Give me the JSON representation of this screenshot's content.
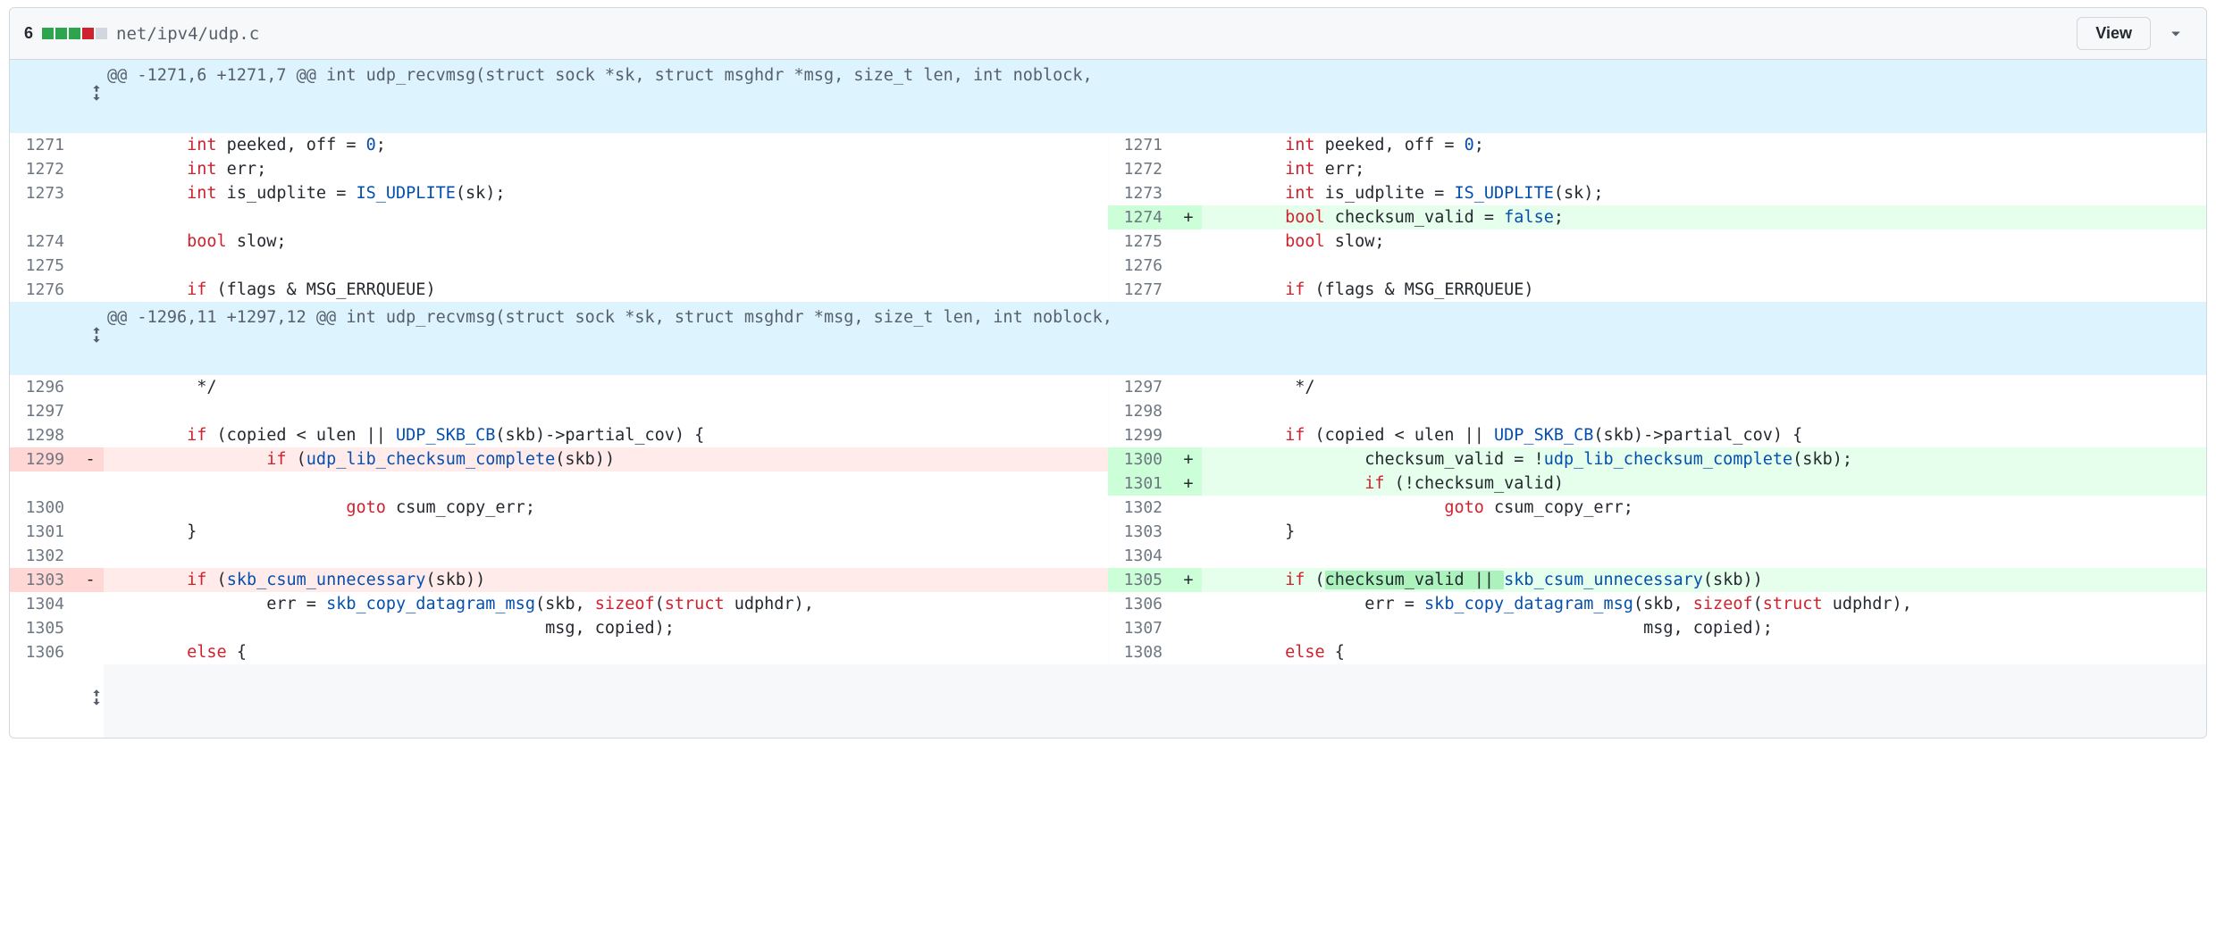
{
  "header": {
    "changes": "6",
    "path": "net/ipv4/udp.c",
    "view_label": "View"
  },
  "hunk1": "@@ -1271,6 +1271,7 @@ int udp_recvmsg(struct sock *sk, struct msghdr *msg, size_t len, int noblock,",
  "hunk2": "@@ -1296,11 +1297,12 @@ int udp_recvmsg(struct sock *sk, struct msghdr *msg, size_t len, int noblock,",
  "ln": {
    "l1271": "1271",
    "l1272": "1272",
    "l1273": "1273",
    "l1274": "1274",
    "l1275": "1275",
    "l1276": "1276",
    "l1296": "1296",
    "l1297": "1297",
    "l1298": "1298",
    "l1299": "1299",
    "l1300": "1300",
    "l1301": "1301",
    "l1302": "1302",
    "l1303": "1303",
    "l1304": "1304",
    "l1305": "1305",
    "l1306": "1306",
    "r1271": "1271",
    "r1272": "1272",
    "r1273": "1273",
    "r1274": "1274",
    "r1275": "1275",
    "r1276": "1276",
    "r1277": "1277",
    "r1297": "1297",
    "r1298": "1298",
    "r1299": "1299",
    "r1300": "1300",
    "r1301": "1301",
    "r1302": "1302",
    "r1303": "1303",
    "r1304": "1304",
    "r1305": "1305",
    "r1306": "1306",
    "r1307": "1307",
    "r1308": "1308"
  },
  "t": {
    "plus": "+",
    "minus": "-",
    "int": "int",
    "bool": "bool",
    "if": "if",
    "goto": "goto",
    "else": "else",
    "sizeof": "sizeof",
    "struct": "struct",
    "peeked_off": " peeked, off = ",
    "zero": "0",
    "semi": ";",
    "err": " err;",
    "is_udplite": " is_udplite = ",
    "IS_UDPLITE": "IS_UDPLITE",
    "sk_call": "(sk);",
    "checksum_valid_decl": " checksum_valid = ",
    "false": "false",
    "slow": " slow;",
    "flags": " (flags & MSG_ERRQUEUE)",
    "star_close": " */",
    "copied": " (copied < ulen || ",
    "UDP_SKB_CB": "UDP_SKB_CB",
    "skb_partial": "(skb)->partial_cov) {",
    "udp_lib": "udp_lib_checksum_complete",
    "skb_call": "(skb))",
    "skb_call_semi": "(skb);",
    "if_open": " (",
    "bang": "!",
    "csum_assign": "checksum_valid = !",
    "not_csum_valid": " (!checksum_valid)",
    "goto_csum": " csum_copy_err;",
    "brace_close": "}",
    "skb_csum": "skb_csum_unnecessary",
    "skb_paren": "(skb))",
    "csum_valid_or": "checksum_valid || ",
    "err_assign": "err = ",
    "skb_copy": "skb_copy_datagram_msg",
    "copy_args": "(skb, ",
    "udphdr": " udphdr),",
    "msg_copied": "msg, copied);",
    "else_brace": " {"
  }
}
